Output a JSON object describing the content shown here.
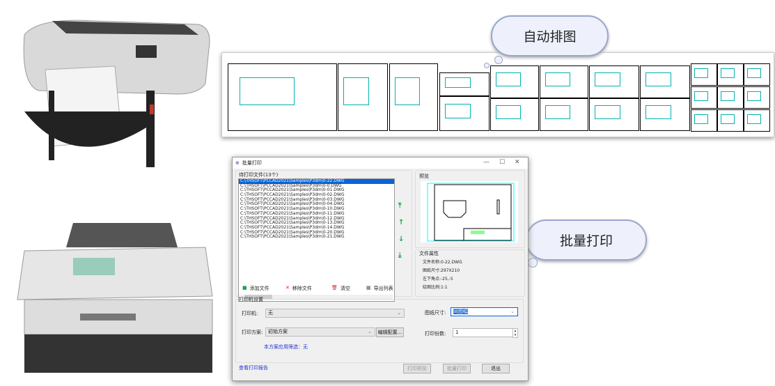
{
  "bubbles": {
    "auto_layout": "自动排图",
    "batch_print": "批量打印"
  },
  "dialog": {
    "title": "批量打印",
    "file_list_label": "待打印文件(13个)",
    "files": [
      "C:\\THSOFT\\PCCAD2021\\Samples\\P3dm\\0-22.DWG",
      "C:\\THSOFT\\PCCAD2021\\Samples\\P3dm\\0-0.DWG",
      "C:\\THSOFT\\PCCAD2021\\Samples\\P3dm\\0-01.DWG",
      "C:\\THSOFT\\PCCAD2021\\Samples\\P3dm\\0-02.DWG",
      "C:\\THSOFT\\PCCAD2021\\Samples\\P3dm\\0-03.DWG",
      "C:\\THSOFT\\PCCAD2021\\Samples\\P3dm\\0-04.DWG",
      "C:\\THSOFT\\PCCAD2021\\Samples\\P3dm\\0-10.DWG",
      "C:\\THSOFT\\PCCAD2021\\Samples\\P3dm\\0-11.DWG",
      "C:\\THSOFT\\PCCAD2021\\Samples\\P3dm\\0-12.DWG",
      "C:\\THSOFT\\PCCAD2021\\Samples\\P3dm\\0-13.DWG",
      "C:\\THSOFT\\PCCAD2021\\Samples\\P3dm\\0-14.DWG",
      "C:\\THSOFT\\PCCAD2021\\Samples\\P3dm\\0-20.DWG",
      "C:\\THSOFT\\PCCAD2021\\Samples\\P3dm\\0-21.DWG"
    ],
    "add_file": "添加文件",
    "remove_file": "移除文件",
    "clear": "清空",
    "export_list": "导出列表",
    "preview_label": "预览",
    "props_label": "文件属性",
    "props": {
      "name": "文件名称:0-22.DWG",
      "size": "图纸尺寸:297X210",
      "corner": "左下角点:-25,-5",
      "scale": "绘图比例:1:1"
    },
    "printer_settings": "打印机设置",
    "printer_label": "打印机:",
    "printer_value": "无",
    "scheme_label": "打印方案:",
    "scheme_value": "初始方案",
    "edit_config": "编辑配置...",
    "scheme_filter": "本方案应用筛选：无",
    "paper_label": "图纸尺寸:",
    "paper_value": "同图幅",
    "copies_label": "打印份数:",
    "copies_value": "1",
    "report_link": "查看打印报告",
    "preview_btn": "打印预览",
    "batch_btn": "批量打印",
    "exit_btn": "退出"
  }
}
